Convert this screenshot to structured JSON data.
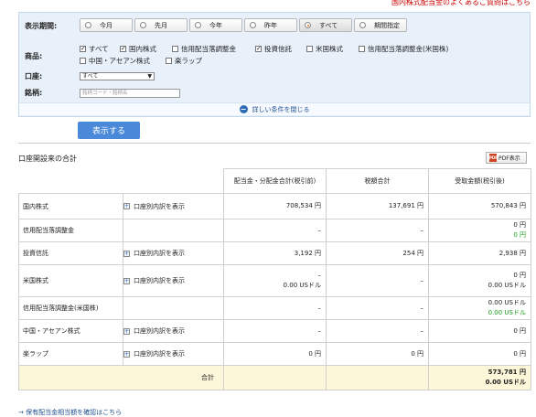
{
  "top_link": "国内株式配当金のよくあるご質問はこちら",
  "filter": {
    "period_label": "表示期間:",
    "periods": [
      "今月",
      "先月",
      "今年",
      "昨年",
      "すべて",
      "期間指定"
    ],
    "selected_period": "すべて",
    "product_label": "商品:",
    "products": [
      {
        "label": "すべて",
        "checked": true
      },
      {
        "label": "国内株式",
        "checked": true
      },
      {
        "label": "信用配当落調整金",
        "checked": false
      },
      {
        "label": "投資信託",
        "checked": true
      },
      {
        "label": "米国株式",
        "checked": false
      },
      {
        "label": "信用配当落調整金(米国株)",
        "checked": false
      },
      {
        "label": "中国・アセアン株式",
        "checked": false
      },
      {
        "label": "楽ラップ",
        "checked": false
      }
    ],
    "account_label": "口座:",
    "account_value": "すべて",
    "brand_label": "銘柄:",
    "brand_placeholder": "銘柄コード・銘柄名",
    "toggle_label": "詳しい条件を閉じる",
    "show_button": "表示する"
  },
  "section": {
    "title": "口座開設来の合計",
    "pdf_label": "PDF表示"
  },
  "table": {
    "headers": [
      "配当金・分配金合計(税引前)",
      "税額合計",
      "受取金額(税引後)"
    ],
    "detail_label": "口座別内訳を表示",
    "rows": [
      {
        "name": "国内株式",
        "detail": true,
        "c1": [
          "708,534 円"
        ],
        "c2": [
          "137,691 円"
        ],
        "c3": [
          "570,843 円"
        ],
        "c3_green": []
      },
      {
        "name": "信用配当落調整金",
        "detail": false,
        "c1": [
          "–"
        ],
        "c2": [
          "–"
        ],
        "c3": [
          "0 円"
        ],
        "c3_green": [
          "0 円"
        ]
      },
      {
        "name": "投資信託",
        "detail": true,
        "c1": [
          "3,192 円"
        ],
        "c2": [
          "254 円"
        ],
        "c3": [
          "2,938 円"
        ],
        "c3_green": []
      },
      {
        "name": "米国株式",
        "detail": true,
        "c1": [
          "–",
          "0.00 USドル"
        ],
        "c2": [
          "–"
        ],
        "c3": [
          "0 円",
          "0.00 USドル"
        ],
        "c3_green": []
      },
      {
        "name": "信用配当落調整金(米国株)",
        "detail": false,
        "c1": [
          "–"
        ],
        "c2": [
          "–"
        ],
        "c3": [
          "0.00 USドル"
        ],
        "c3_green": [
          "0.00 USドル"
        ]
      },
      {
        "name": "中国・アセアン株式",
        "detail": true,
        "c1": [
          "–"
        ],
        "c2": [
          "–"
        ],
        "c3": [
          "0 円"
        ],
        "c3_green": []
      },
      {
        "name": "楽ラップ",
        "detail": true,
        "c1": [
          "0 円"
        ],
        "c2": [
          "0 円"
        ],
        "c3": [
          "0 円"
        ],
        "c3_green": []
      }
    ],
    "total_label": "合計",
    "total_values": [
      "573,781 円",
      "0.00 USドル"
    ]
  },
  "bottom_link": "→ 保有配当金相当額を確認はこちら"
}
